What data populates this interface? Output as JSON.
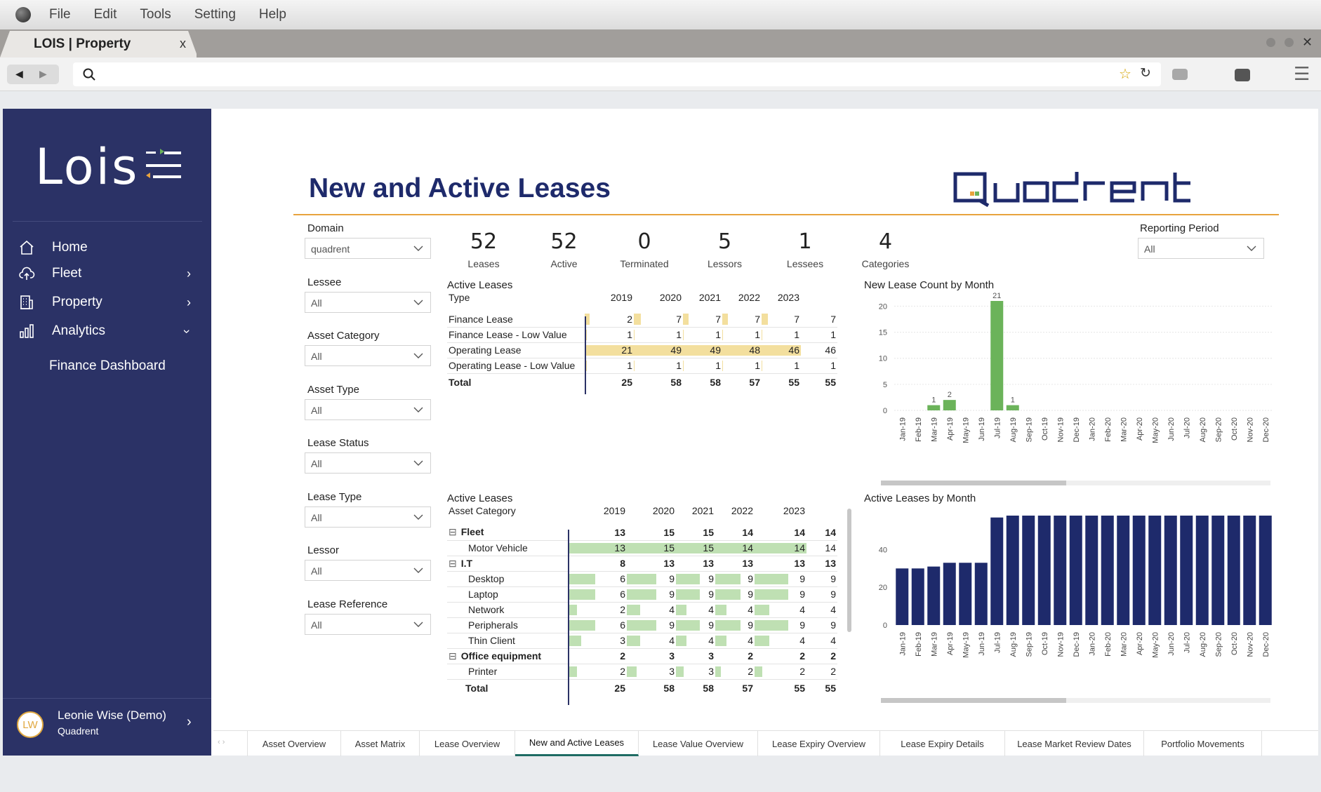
{
  "menubar": {
    "items": [
      "File",
      "Edit",
      "Tools",
      "Setting",
      "Help"
    ]
  },
  "browser": {
    "tab_title": "LOIS | Property",
    "tab_close": "x"
  },
  "sidebar": {
    "logo": "Lois",
    "items": [
      {
        "label": "Home"
      },
      {
        "label": "Fleet"
      },
      {
        "label": "Property"
      },
      {
        "label": "Analytics"
      }
    ],
    "sub_item": "Finance Dashboard",
    "user": {
      "name": "Leonie Wise (Demo)",
      "org": "Quadrent",
      "initials": "LW"
    }
  },
  "report": {
    "title": "New and Active Leases",
    "brand": "Quadrent",
    "accent": "#e8a33d",
    "navy": "#1e2a6b"
  },
  "filters": [
    {
      "label": "Domain",
      "value": "quadrent"
    },
    {
      "label": "Lessee",
      "value": "All"
    },
    {
      "label": "Asset Category",
      "value": "All"
    },
    {
      "label": "Asset Type",
      "value": "All"
    },
    {
      "label": "Lease Status",
      "value": "All"
    },
    {
      "label": "Lease Type",
      "value": "All"
    },
    {
      "label": "Lessor",
      "value": "All"
    },
    {
      "label": "Lease Reference",
      "value": "All"
    }
  ],
  "reporting_period": {
    "label": "Reporting Period",
    "value": "All"
  },
  "kpis": [
    {
      "value": "52",
      "label": "Leases"
    },
    {
      "value": "52",
      "label": "Active"
    },
    {
      "value": "0",
      "label": "Terminated"
    },
    {
      "value": "5",
      "label": "Lessors"
    },
    {
      "value": "1",
      "label": "Lessees"
    },
    {
      "value": "4",
      "label": "Categories"
    }
  ],
  "table1": {
    "title": "Active Leases",
    "header": [
      "Type",
      "2019",
      "2020",
      "2021",
      "2022",
      "2023"
    ],
    "rows": [
      {
        "name": "Finance Lease",
        "values": [
          "2",
          "7",
          "7",
          "7",
          "7",
          "7"
        ]
      },
      {
        "name": "Finance Lease - Low Value",
        "values": [
          "1",
          "1",
          "1",
          "1",
          "1",
          "1"
        ]
      },
      {
        "name": "Operating Lease",
        "values": [
          "21",
          "49",
          "49",
          "48",
          "46",
          "46"
        ]
      },
      {
        "name": "Operating Lease - Low Value",
        "values": [
          "1",
          "1",
          "1",
          "1",
          "1",
          "1"
        ]
      }
    ],
    "total": {
      "name": "Total",
      "values": [
        "25",
        "58",
        "58",
        "57",
        "55",
        "55"
      ]
    }
  },
  "table2": {
    "title": "Active Leases",
    "header": [
      "Asset Category",
      "2019",
      "2020",
      "2021",
      "2022",
      "2023"
    ],
    "rows": [
      {
        "name": "Fleet",
        "group": true,
        "expander": "⊟",
        "values": [
          "13",
          "15",
          "15",
          "14",
          "14",
          "14"
        ]
      },
      {
        "name": "Motor Vehicle",
        "group": false,
        "values": [
          "13",
          "15",
          "15",
          "14",
          "14",
          "14"
        ]
      },
      {
        "name": "I.T",
        "group": true,
        "expander": "⊟",
        "values": [
          "8",
          "13",
          "13",
          "13",
          "13",
          "13"
        ]
      },
      {
        "name": "Desktop",
        "group": false,
        "values": [
          "6",
          "9",
          "9",
          "9",
          "9",
          "9"
        ]
      },
      {
        "name": "Laptop",
        "group": false,
        "values": [
          "6",
          "9",
          "9",
          "9",
          "9",
          "9"
        ]
      },
      {
        "name": "Network",
        "group": false,
        "values": [
          "2",
          "4",
          "4",
          "4",
          "4",
          "4"
        ]
      },
      {
        "name": "Peripherals",
        "group": false,
        "values": [
          "6",
          "9",
          "9",
          "9",
          "9",
          "9"
        ]
      },
      {
        "name": "Thin Client",
        "group": false,
        "values": [
          "3",
          "4",
          "4",
          "4",
          "4",
          "4"
        ]
      },
      {
        "name": "Office equipment",
        "group": true,
        "expander": "⊟",
        "values": [
          "2",
          "3",
          "3",
          "2",
          "2",
          "2"
        ]
      },
      {
        "name": "Printer",
        "group": false,
        "values": [
          "2",
          "3",
          "3",
          "2",
          "2",
          "2"
        ]
      }
    ],
    "total": {
      "name": "Total",
      "values": [
        "25",
        "58",
        "58",
        "57",
        "55",
        "55"
      ]
    }
  },
  "chart_data": [
    {
      "type": "bar",
      "title": "New Lease Count by Month",
      "categories": [
        "Jan-19",
        "Feb-19",
        "Mar-19",
        "Apr-19",
        "May-19",
        "Jun-19",
        "Jul-19",
        "Aug-19",
        "Sep-19",
        "Oct-19",
        "Nov-19",
        "Dec-19",
        "Jan-20",
        "Feb-20",
        "Mar-20",
        "Apr-20",
        "May-20",
        "Jun-20",
        "Jul-20",
        "Aug-20",
        "Sep-20",
        "Oct-20",
        "Nov-20",
        "Dec-20"
      ],
      "values": [
        0,
        0,
        1,
        2,
        0,
        0,
        21,
        1,
        0,
        0,
        0,
        0,
        0,
        0,
        0,
        0,
        0,
        0,
        0,
        0,
        0,
        0,
        0,
        0
      ],
      "data_labels": [
        "",
        "",
        "1",
        "2",
        "",
        "",
        "21",
        "1",
        "",
        "",
        "",
        "",
        "",
        "",
        "",
        "",
        "",
        "",
        "",
        "",
        "",
        "",
        "",
        ""
      ],
      "yticks": [
        "0",
        "5",
        "10",
        "15",
        "20"
      ],
      "ylim": [
        0,
        21
      ],
      "color": "#6bb35a",
      "grid": true
    },
    {
      "type": "bar",
      "title": "Active Leases by Month",
      "categories": [
        "Jan-19",
        "Feb-19",
        "Mar-19",
        "Apr-19",
        "May-19",
        "Jun-19",
        "Jul-19",
        "Aug-19",
        "Sep-19",
        "Oct-19",
        "Nov-19",
        "Dec-19",
        "Jan-20",
        "Feb-20",
        "Mar-20",
        "Apr-20",
        "May-20",
        "Jun-20",
        "Jul-20",
        "Aug-20",
        "Sep-20",
        "Oct-20",
        "Nov-20",
        "Dec-20"
      ],
      "values": [
        30,
        30,
        31,
        33,
        33,
        33,
        57,
        58,
        58,
        58,
        58,
        58,
        58,
        58,
        58,
        58,
        58,
        58,
        58,
        58,
        58,
        58,
        58,
        58
      ],
      "yticks": [
        "0",
        "20",
        "40"
      ],
      "ylim": [
        0,
        58
      ],
      "color": "#1e2a6b",
      "grid": false
    }
  ],
  "bottom_tabs": [
    {
      "label": "Asset Overview",
      "active": false
    },
    {
      "label": "Asset Matrix",
      "active": false
    },
    {
      "label": "Lease Overview",
      "active": false
    },
    {
      "label": "New and Active Leases",
      "active": true
    },
    {
      "label": "Lease Value Overview",
      "active": false
    },
    {
      "label": "Lease Expiry Overview",
      "active": false
    },
    {
      "label": "Lease Expiry Details",
      "active": false
    },
    {
      "label": "Lease Market Review Dates",
      "active": false
    },
    {
      "label": "Portfolio Movements",
      "active": false
    }
  ]
}
